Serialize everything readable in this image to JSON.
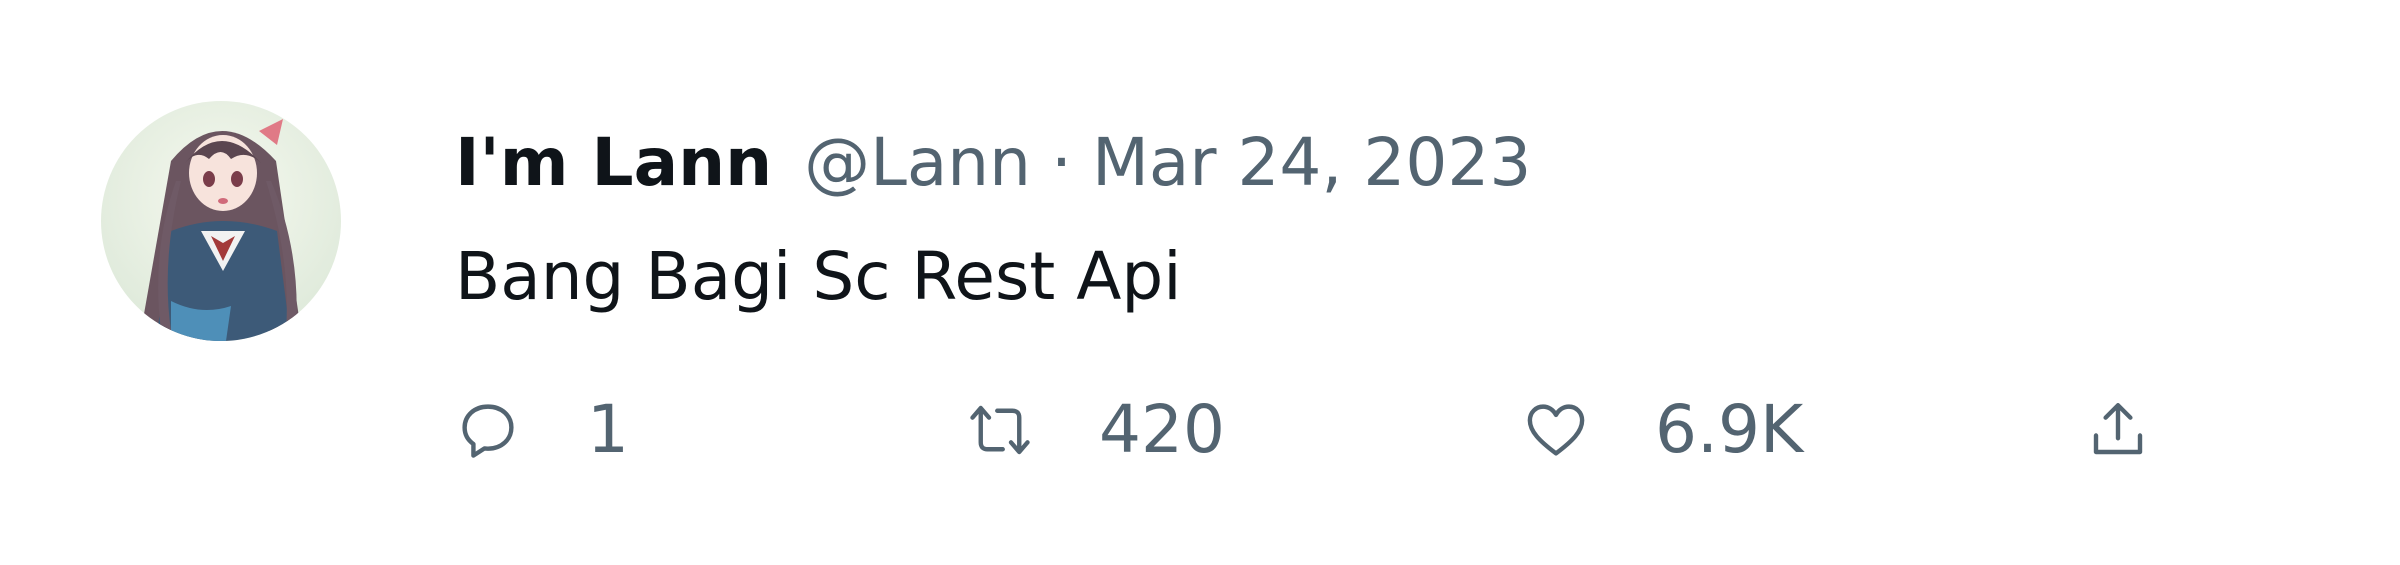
{
  "tweet": {
    "author": {
      "display_name": "I'm Lann",
      "handle": "@Lann"
    },
    "separator": "·",
    "date": "Mar 24, 2023",
    "text": "Bang Bagi Sc Rest Api",
    "metrics": {
      "replies": "1",
      "retweets": "420",
      "likes": "6.9K"
    }
  },
  "icons": {
    "reply": "reply-bubble-icon",
    "retweet": "retweet-arrows-icon",
    "like": "heart-icon",
    "share": "share-upload-icon"
  },
  "colors": {
    "name": "#0f1419",
    "secondary": "#536471",
    "text": "#0f1419",
    "background": "#ffffff"
  }
}
